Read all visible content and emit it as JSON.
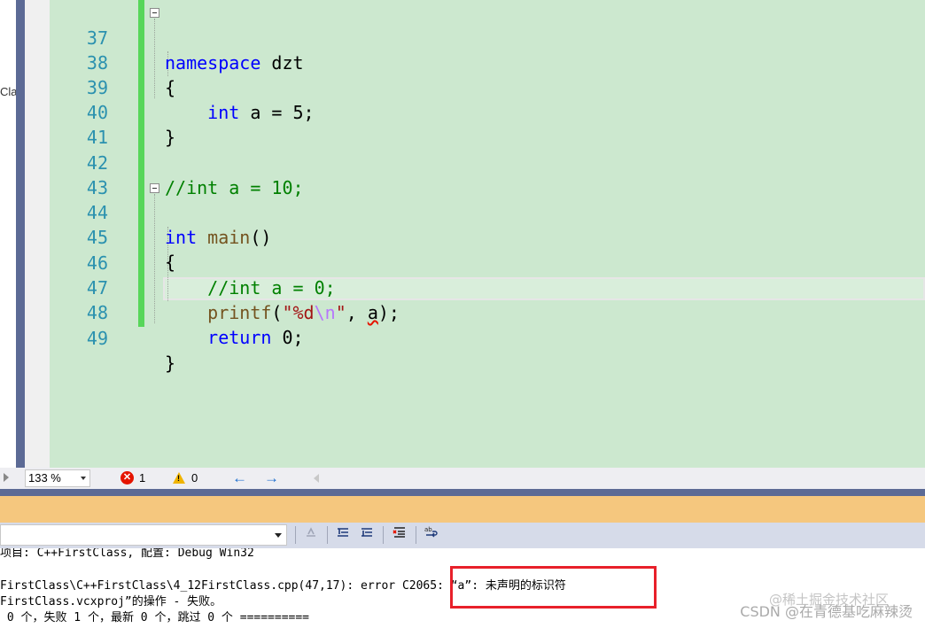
{
  "sidebar": {
    "partial_label": "Cla"
  },
  "editor": {
    "lines": [
      {
        "num": "37"
      },
      {
        "num": "38"
      },
      {
        "num": "39"
      },
      {
        "num": "40"
      },
      {
        "num": "41"
      },
      {
        "num": "42"
      },
      {
        "num": "43"
      },
      {
        "num": "44"
      },
      {
        "num": "45"
      },
      {
        "num": "46"
      },
      {
        "num": "47"
      },
      {
        "num": "48"
      },
      {
        "num": "49"
      }
    ],
    "tokens": {
      "l37_kw": "namespace",
      "l37_rest": " dzt",
      "open_brace": "{",
      "close_brace": "}",
      "l39_kw": "int",
      "l39_rest": " a = 5;",
      "l42_comment": "//int a = 10;",
      "l44_kw": "int",
      "l44_fn": "main",
      "l44_rest": "()",
      "l46_comment": "//int a = 0;",
      "l47_fn": "printf",
      "l47_p1": "(",
      "l47_str1": "\"%d",
      "l47_esc": "\\n",
      "l47_str2": "\"",
      "l47_p2": ", ",
      "l47_var": "a",
      "l47_p3": ");",
      "l48_kw": "return",
      "l48_rest": " 0;"
    }
  },
  "statusbar": {
    "zoom": "133 %",
    "errors": "1",
    "warnings": "0",
    "error_icon_glyph": "✕",
    "back_arrow": "←",
    "forward_arrow": "→"
  },
  "output_toolbar": {
    "icons": [
      "clear-icon",
      "prev-message-icon",
      "next-message-icon",
      "clear-all-icon",
      "word-wrap-icon"
    ]
  },
  "output": {
    "line1": "项目: C++FirstClass, 配置: Debug Win32",
    "line2": "FirstClass\\C++FirstClass\\4_12FirstClass.cpp(47,17): error C2065: “a”: 未声明的标识符",
    "line3": "FirstClass.vcxproj”的操作 - 失败。",
    "line4": " 0 个，失败 1 个，最新 0 个，跳过 0 个 =========="
  },
  "watermark": {
    "text": "CSDN @在青德基吃麻辣烫",
    "text2": "@稀土掘金技术社区"
  },
  "colors": {
    "editor_bg": "#cce8cf",
    "keyword": "#0000ff",
    "comment": "#008000",
    "line_number": "#2b91af",
    "change_bar": "#57d65a",
    "error_red": "#e51400",
    "panel_orange": "#f5c77e"
  }
}
